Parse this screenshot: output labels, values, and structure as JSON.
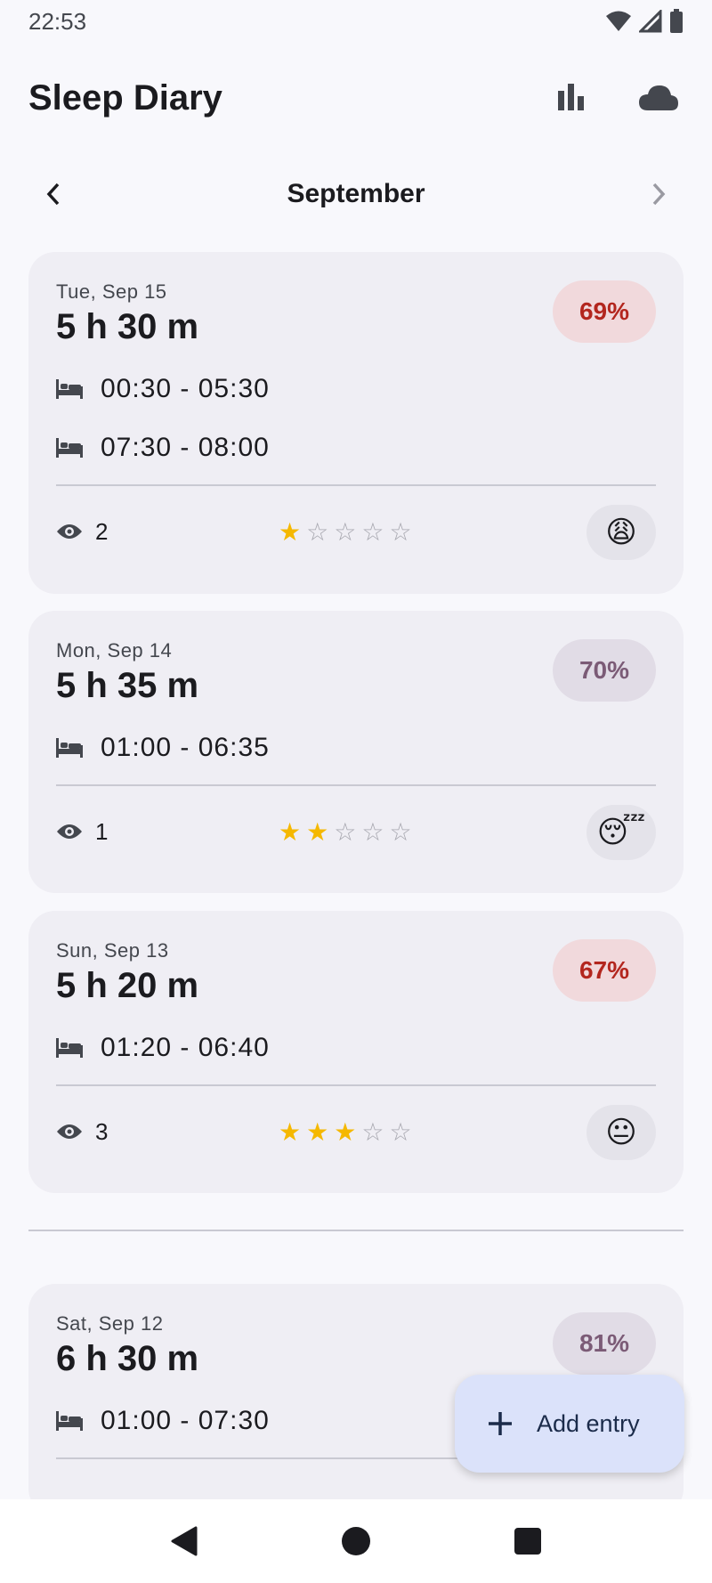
{
  "status_bar": {
    "time": "22:53"
  },
  "app_bar": {
    "title": "Sleep Diary"
  },
  "month_nav": {
    "month": "September"
  },
  "entries": [
    {
      "date": "Tue, Sep 15",
      "duration": "5 h 30 m",
      "score": "69%",
      "score_level": "low",
      "periods": [
        "00:30 - 05:30",
        "07:30 - 08:00"
      ],
      "wakeups": "2",
      "rating": 1,
      "mood": "😩"
    },
    {
      "date": "Mon, Sep 14",
      "duration": "5 h 35 m",
      "score": "70%",
      "score_level": "mid",
      "periods": [
        "01:00 - 06:35"
      ],
      "wakeups": "1",
      "rating": 2,
      "mood": "😴"
    },
    {
      "date": "Sun, Sep 13",
      "duration": "5 h 20 m",
      "score": "67%",
      "score_level": "low",
      "periods": [
        "01:20 - 06:40"
      ],
      "wakeups": "3",
      "rating": 3,
      "mood": "😐"
    },
    {
      "date": "Sat, Sep 12",
      "duration": "6 h 30 m",
      "score": "81%",
      "score_level": "mid",
      "periods": [
        "01:00 - 07:30"
      ]
    }
  ],
  "fab": {
    "label": "Add entry"
  },
  "colors": {
    "score_low_bg": "#f1d9dc",
    "score_low_text": "#b3261e",
    "score_mid_bg": "#e1dce6",
    "score_mid_text": "#7b5b76",
    "star": "#f5b800",
    "fab_bg": "#dbe2fa"
  }
}
